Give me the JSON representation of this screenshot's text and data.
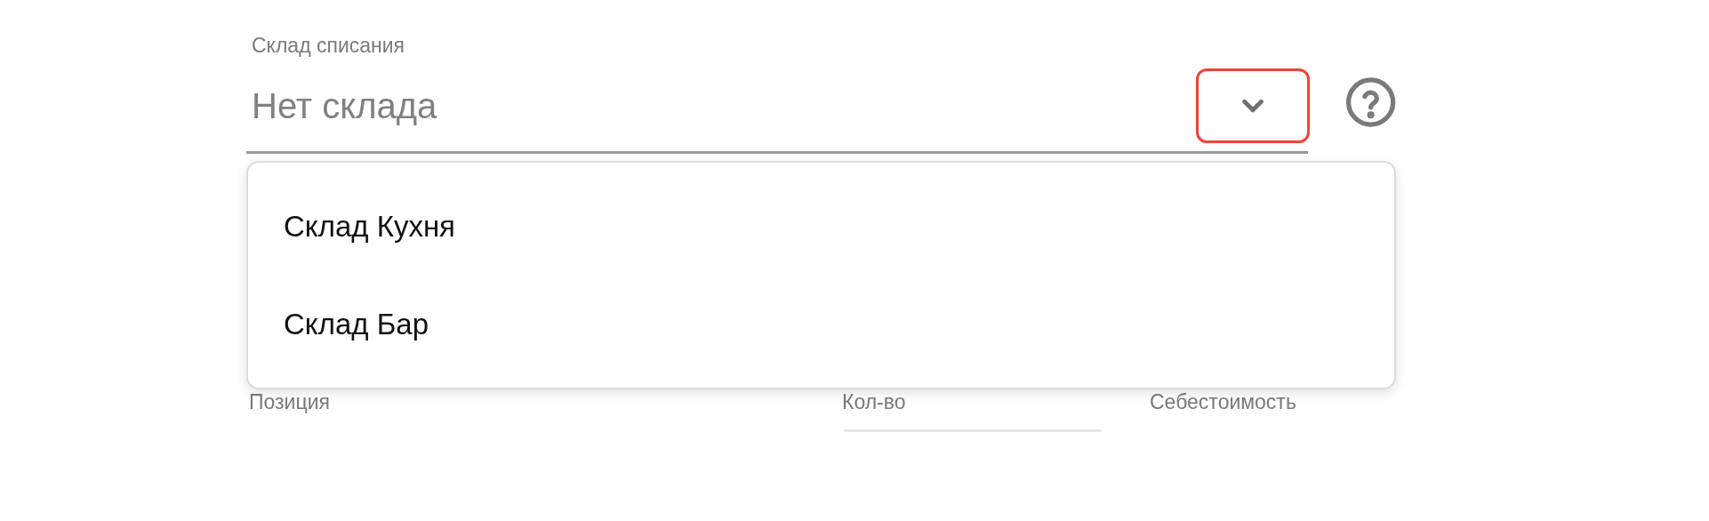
{
  "field": {
    "label": "Склад списания",
    "placeholder": "Нет склада",
    "expanded": true
  },
  "menu": {
    "options": [
      {
        "label": "Склад Кухня"
      },
      {
        "label": "Склад Бар"
      }
    ]
  },
  "table": {
    "columns": [
      "Позиция",
      "Кол-во",
      "Себестоимость"
    ]
  }
}
